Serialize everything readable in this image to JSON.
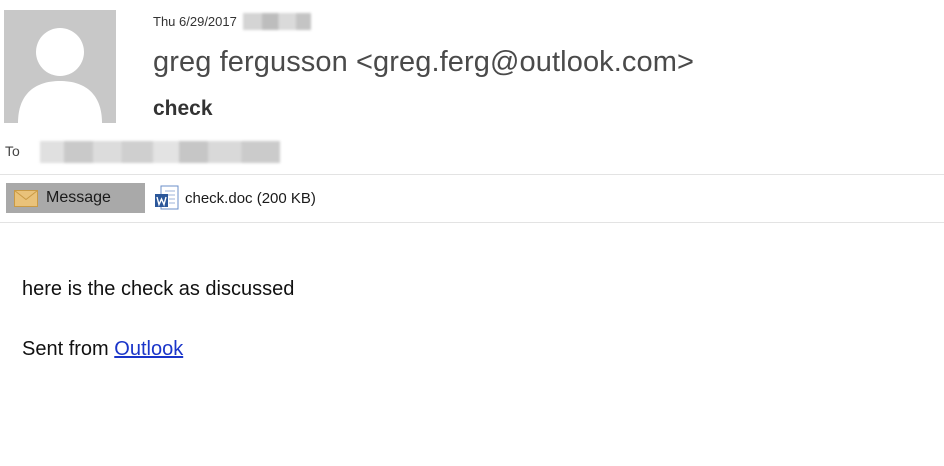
{
  "header": {
    "date": "Thu 6/29/2017",
    "sender": "greg fergusson <greg.ferg@outlook.com>",
    "subject": "check",
    "to_label": "To"
  },
  "attachments_bar": {
    "message_tab_label": "Message",
    "attachment_label": "check.doc (200 KB)"
  },
  "body": {
    "line1": "here is the check as discussed",
    "sent_from_prefix": "Sent from ",
    "sent_from_link": "Outlook"
  },
  "icons": {
    "avatar": "default-user-avatar-icon",
    "message_tab": "envelope-icon",
    "attachment": "word-document-icon"
  },
  "colors": {
    "avatar_bg": "#c8c8c8",
    "message_tab_bg": "#a9a9a9",
    "link": "#1a35c9"
  }
}
